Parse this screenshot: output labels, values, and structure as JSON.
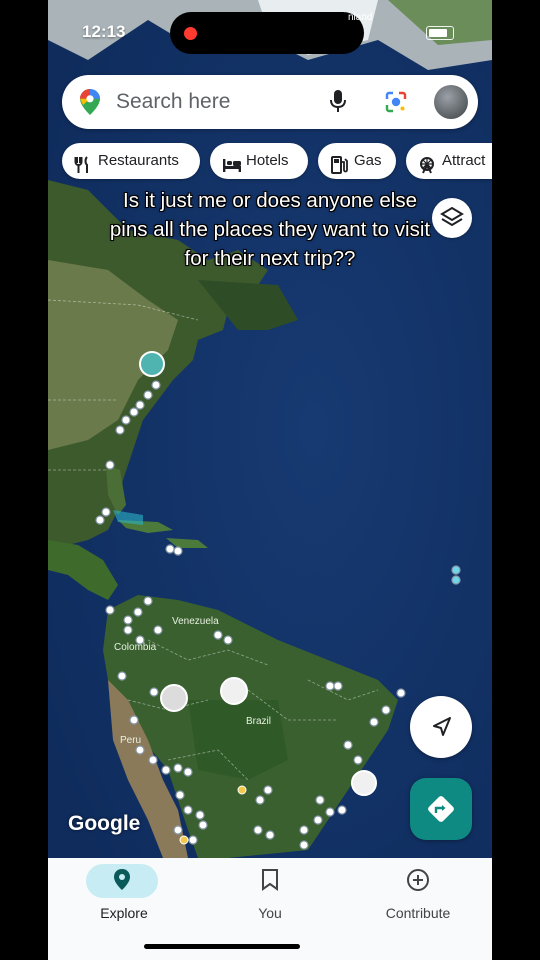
{
  "status": {
    "time": "12:13",
    "top_right": "nland"
  },
  "search": {
    "placeholder": "Search here"
  },
  "chips": [
    {
      "label": "Restaurants",
      "icon": "fork-knife-icon"
    },
    {
      "label": "Hotels",
      "icon": "bed-icon"
    },
    {
      "label": "Gas",
      "icon": "gas-pump-icon"
    },
    {
      "label": "Attract",
      "icon": "ferris-wheel-icon"
    }
  ],
  "caption": {
    "line1": "Is it just me or does anyone else",
    "line2": "pins all the places they want to visit",
    "line3": "for their next trip??"
  },
  "map": {
    "labels": {
      "venezuela": "Venezuela",
      "colombia": "Colombia",
      "brazil": "Brazil",
      "peru": "Peru"
    },
    "brand": "Google"
  },
  "nav": {
    "explore": "Explore",
    "you": "You",
    "contribute": "Contribute"
  },
  "colors": {
    "accent": "#0e8a82",
    "explore_pill": "#c8ecf4",
    "ocean": "#1d3d73",
    "land": "#3a5a2a"
  }
}
